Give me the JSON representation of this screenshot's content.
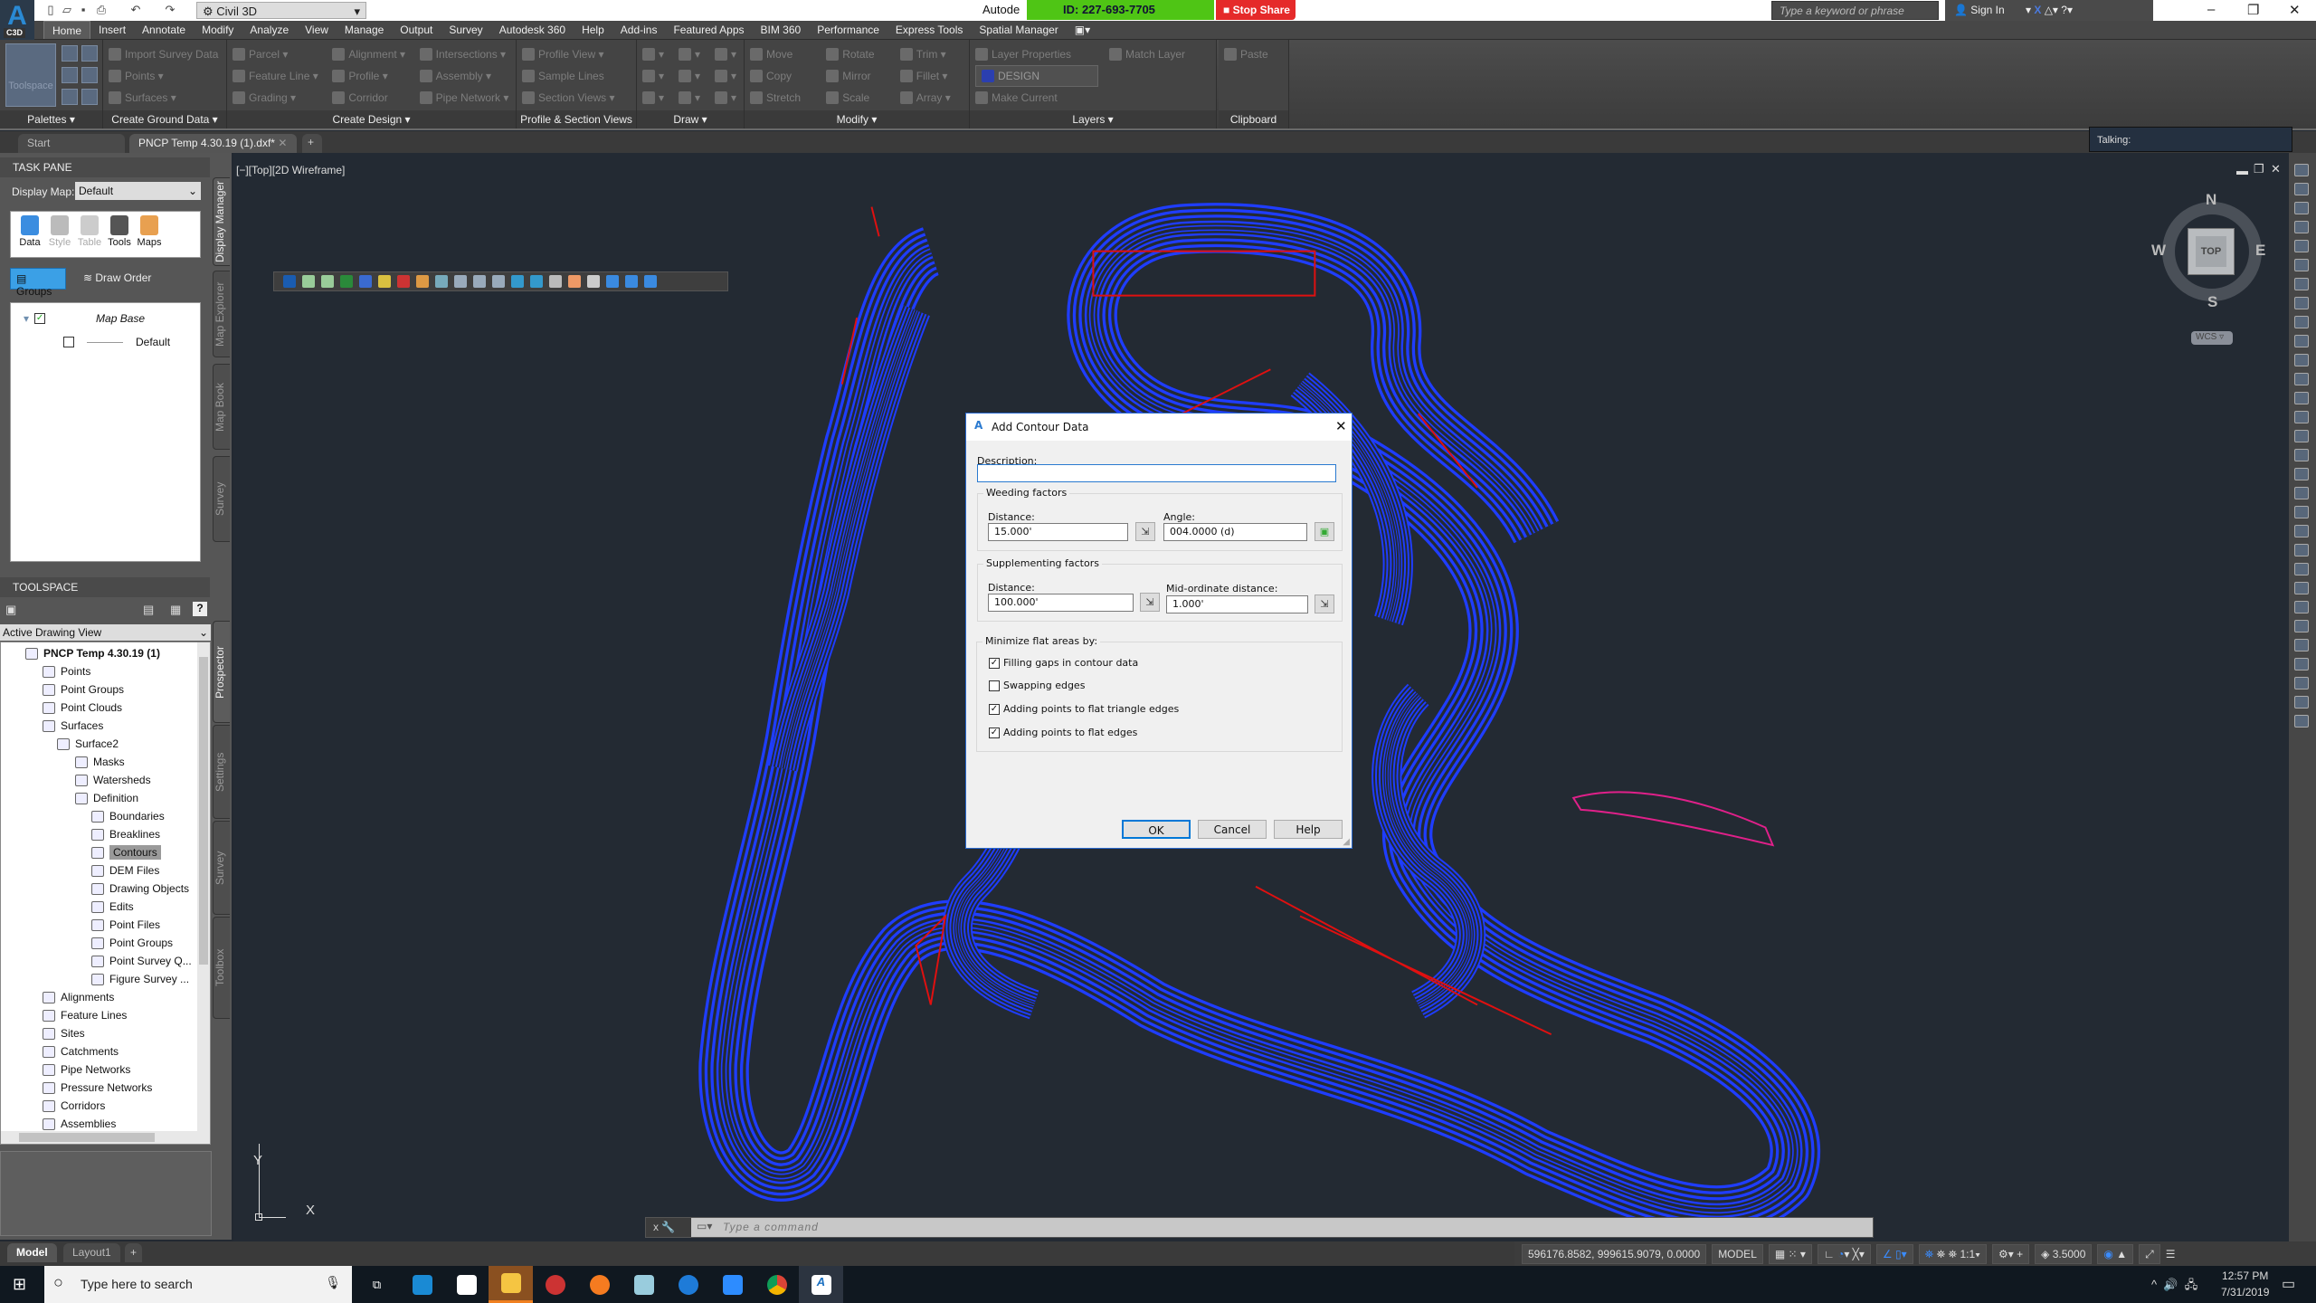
{
  "titlebar": {
    "app_badge": "C3D",
    "workspace": "Civil 3D",
    "title_partial": "Autode",
    "share_id": "ID: 227-693-7705",
    "stop_share": "Stop Share",
    "search_placeholder": "Type a keyword or phrase",
    "sign_in": "Sign In"
  },
  "menu_tabs": [
    "Home",
    "Insert",
    "Annotate",
    "Modify",
    "Analyze",
    "View",
    "Manage",
    "Output",
    "Survey",
    "Autodesk 360",
    "Help",
    "Add-ins",
    "Featured Apps",
    "BIM 360",
    "Performance",
    "Express Tools",
    "Spatial Manager"
  ],
  "ribbon": {
    "panels": [
      {
        "label": "Palettes ▾",
        "items": [
          "Toolspace"
        ]
      },
      {
        "label": "Create Ground Data ▾",
        "items": [
          "Import Survey Data",
          "Points ▾",
          "Surfaces ▾"
        ]
      },
      {
        "label": "Create Design ▾",
        "items": [
          "Parcel ▾",
          "Feature Line ▾",
          "Grading ▾",
          "Alignment ▾",
          "Profile ▾",
          "Corridor",
          "Intersections ▾",
          "Assembly ▾",
          "Pipe Network ▾"
        ]
      },
      {
        "label": "Profile & Section Views",
        "items": [
          "Profile View ▾",
          "Sample Lines",
          "Section Views ▾"
        ]
      },
      {
        "label": "Draw ▾",
        "items": []
      },
      {
        "label": "Modify ▾",
        "items": [
          "Move",
          "Copy",
          "Stretch",
          "Rotate",
          "Mirror",
          "Scale",
          "Trim ▾",
          "Fillet ▾",
          "Array ▾"
        ]
      },
      {
        "label": "Layers ▾",
        "items": [
          "Layer Properties",
          "DESIGN",
          "Make Current",
          "Match Layer"
        ]
      },
      {
        "label": "Clipboard",
        "items": [
          "Paste"
        ]
      }
    ]
  },
  "doc_tabs": {
    "start": "Start",
    "active": "PNCP Temp 4.30.19 (1).dxf*"
  },
  "talking": "Talking:",
  "task_pane": {
    "title": "TASK PANE",
    "display_map_label": "Display Map:",
    "display_map_value": "Default",
    "tools": [
      "Data",
      "Style",
      "Table",
      "Tools",
      "Maps"
    ],
    "groups": "Groups",
    "draw_order": "Draw Order",
    "tree": [
      {
        "label": "Map Base",
        "checked": true
      },
      {
        "label": "Default",
        "checked": false
      }
    ],
    "side_tabs": [
      "Display Manager",
      "Map Explorer",
      "Map Book",
      "Survey"
    ]
  },
  "toolspace": {
    "title": "TOOLSPACE",
    "view": "Active Drawing View",
    "side_tabs": [
      "Prospector",
      "Settings",
      "Survey",
      "Toolbox"
    ],
    "tree": [
      {
        "label": "PNCP Temp 4.30.19 (1)",
        "level": 0,
        "bold": true
      },
      {
        "label": "Points",
        "level": 1
      },
      {
        "label": "Point Groups",
        "level": 1
      },
      {
        "label": "Point Clouds",
        "level": 1
      },
      {
        "label": "Surfaces",
        "level": 1
      },
      {
        "label": "Surface2",
        "level": 2
      },
      {
        "label": "Masks",
        "level": 3
      },
      {
        "label": "Watersheds",
        "level": 3
      },
      {
        "label": "Definition",
        "level": 3
      },
      {
        "label": "Boundaries",
        "level": 4
      },
      {
        "label": "Breaklines",
        "level": 4
      },
      {
        "label": "Contours",
        "level": 4,
        "selected": true
      },
      {
        "label": "DEM Files",
        "level": 4
      },
      {
        "label": "Drawing Objects",
        "level": 4
      },
      {
        "label": "Edits",
        "level": 4
      },
      {
        "label": "Point Files",
        "level": 4
      },
      {
        "label": "Point Groups",
        "level": 4
      },
      {
        "label": "Point Survey Q...",
        "level": 4
      },
      {
        "label": "Figure Survey ...",
        "level": 4
      },
      {
        "label": "Alignments",
        "level": 1
      },
      {
        "label": "Feature Lines",
        "level": 1
      },
      {
        "label": "Sites",
        "level": 1
      },
      {
        "label": "Catchments",
        "level": 1
      },
      {
        "label": "Pipe Networks",
        "level": 1
      },
      {
        "label": "Pressure Networks",
        "level": 1
      },
      {
        "label": "Corridors",
        "level": 1
      },
      {
        "label": "Assemblies",
        "level": 1
      }
    ]
  },
  "viewport": {
    "label": "[−][Top][2D Wireframe]",
    "viewcube": {
      "n": "N",
      "s": "S",
      "e": "E",
      "w": "W",
      "face": "TOP",
      "ucs": "WCS"
    },
    "ucs_x": "X",
    "ucs_y": "Y",
    "contour_color": "#1f3dff",
    "linework_color": "#e01010",
    "boundary_color": "#e0208a"
  },
  "command": {
    "placeholder": "Type a command"
  },
  "layout_tabs": [
    "Model",
    "Layout1"
  ],
  "status": {
    "coords": "596176.8582, 999615.9079, 0.0000",
    "space": "MODEL",
    "scale": "1:1",
    "annotation": "3.5000"
  },
  "dialog": {
    "title": "Add Contour Data",
    "description_label": "Description:",
    "description_value": "",
    "weeding": {
      "title": "Weeding factors",
      "distance_label": "Distance:",
      "distance": "15.000'",
      "angle_label": "Angle:",
      "angle": "004.0000 (d)"
    },
    "supplementing": {
      "title": "Supplementing factors",
      "distance_label": "Distance:",
      "distance": "100.000'",
      "midord_label": "Mid-ordinate distance:",
      "midord": "1.000'"
    },
    "minimize": {
      "title": "Minimize flat areas by:",
      "options": [
        {
          "label": "Filling gaps in contour data",
          "checked": true
        },
        {
          "label": "Swapping edges",
          "checked": false
        },
        {
          "label": "Adding points to flat triangle edges",
          "checked": true
        },
        {
          "label": "Adding points to flat edges",
          "checked": true
        }
      ]
    },
    "ok": "OK",
    "cancel": "Cancel",
    "help": "Help"
  },
  "taskbar": {
    "search_placeholder": "Type here to search",
    "time": "12:57 PM",
    "date": "7/31/2019"
  }
}
